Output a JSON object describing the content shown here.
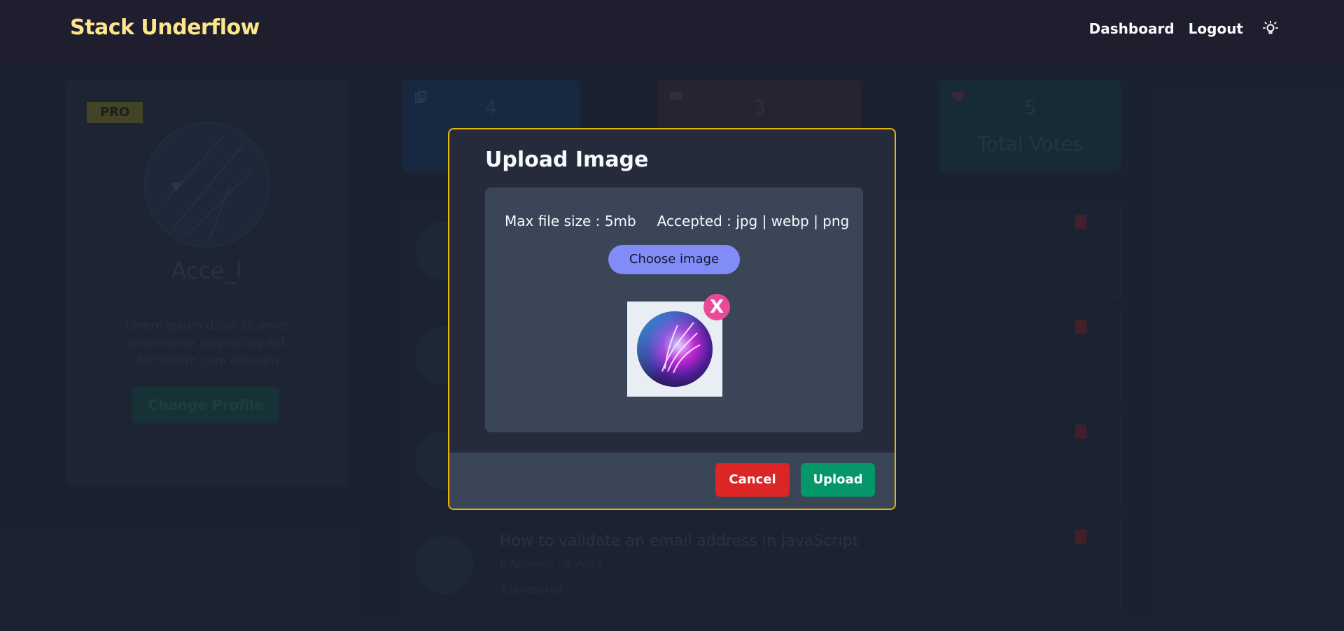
{
  "navbar": {
    "brand": "Stack Underflow",
    "links": [
      "Dashboard",
      "Logout"
    ],
    "theme_icon": "lightbulb-icon"
  },
  "profile": {
    "badge": "PRO",
    "name": "Acce_l",
    "bio": "Lorem ipsum dolor sit amet consectetur adipisicing elit. Architecto cum aliquam",
    "change_button": "Change Profile"
  },
  "stats": [
    {
      "value": "4",
      "icon": "copy-icon"
    },
    {
      "value": "3",
      "icon": "message-icon"
    },
    {
      "value": "5",
      "label": "Total Votes",
      "icon": "heart-icon"
    }
  ],
  "questions": [
    {
      "title": "How to validate an email address in JavaScript",
      "meta": "0 Answers · 0 Votes",
      "tag": "#javascript"
    }
  ],
  "modal": {
    "title": "Upload Image",
    "max_size": "Max file size : 5mb",
    "accepted": "Accepted : jpg | webp | png",
    "choose_label": "Choose image",
    "remove_label": "X",
    "cancel_label": "Cancel",
    "upload_label": "Upload"
  },
  "colors": {
    "accent_border": "#eab308",
    "choose_button": "#818cf8",
    "cancel_button": "#dc2626",
    "upload_button": "#059669",
    "remove_button": "#ec4899",
    "brand_text": "#fde68a"
  }
}
